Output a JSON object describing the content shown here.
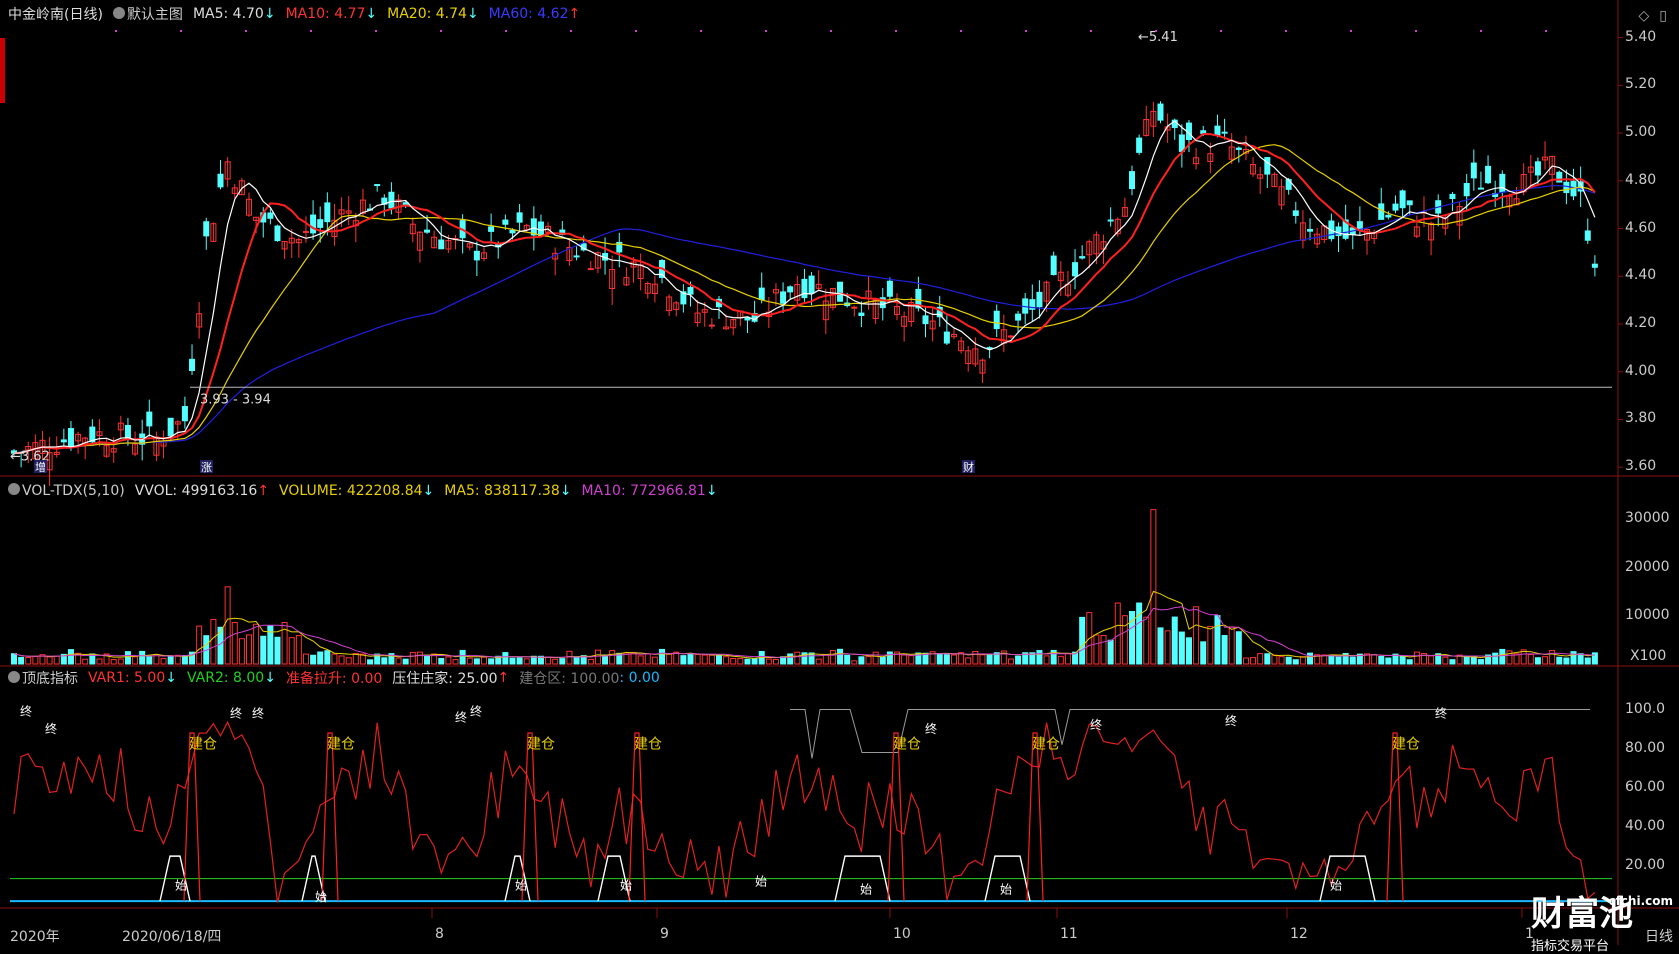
{
  "main_header": {
    "stock": "中金岭南(日线)",
    "main_chart": "默认主图",
    "ma5": "MA5: 4.70",
    "ma10": "MA10: 4.77",
    "ma20": "MA20: 4.74",
    "ma60": "MA60: 4.62"
  },
  "vol_header": {
    "name": "VOL-TDX(5,10)",
    "vvol": "VVOL: 499163.16",
    "volume": "VOLUME: 422208.84",
    "ma5": "MA5: 838117.38",
    "ma10": "MA10: 772966.81"
  },
  "ind_header": {
    "name": "顶底指标",
    "var1": "VAR1: 5.00",
    "var2": "VAR2: 8.00",
    "zhunbei": "准备拉升: 0.00",
    "yazhu": "压住庄家: 25.00",
    "jiancang": "建仓区: 100.00",
    "val": ": 0.00"
  },
  "price_axis": [
    "5.40",
    "5.20",
    "5.00",
    "4.80",
    "4.60",
    "4.40",
    "4.20",
    "4.00",
    "3.80",
    "3.60"
  ],
  "vol_axis": [
    "30000",
    "20000",
    "10000",
    "X100"
  ],
  "ind_axis": [
    "100.0",
    "80.00",
    "60.00",
    "40.00",
    "20.00"
  ],
  "date_labels": [
    "2020年",
    "2020/06/18/四",
    "8",
    "9",
    "10",
    "11",
    "12",
    "1"
  ],
  "annotations": {
    "high": "5.41",
    "low": "3.62",
    "range": "3.93 - 3.94",
    "mark1": "增",
    "mark2": "涨",
    "mark3": "财",
    "jiancang": "建仓",
    "zhong": "终",
    "shi": "始"
  },
  "bottom_tab": "日线",
  "watermark": {
    "name": "财富池",
    "sub": "指标交易平台",
    "url": "cfchi.com"
  },
  "colors": {
    "up": "#ff3232",
    "down": "#54ffff",
    "ma5": "#ffffff",
    "ma10": "#ff2020",
    "ma20": "#e8d000",
    "ma60": "#2020e0"
  },
  "chart_data": {
    "type": "candlestick",
    "ylim": [
      3.58,
      5.44
    ],
    "high": 5.41,
    "low": 3.62,
    "ma_last": {
      "ma5": 4.7,
      "ma10": 4.77,
      "ma20": 4.74,
      "ma60": 4.62
    }
  }
}
